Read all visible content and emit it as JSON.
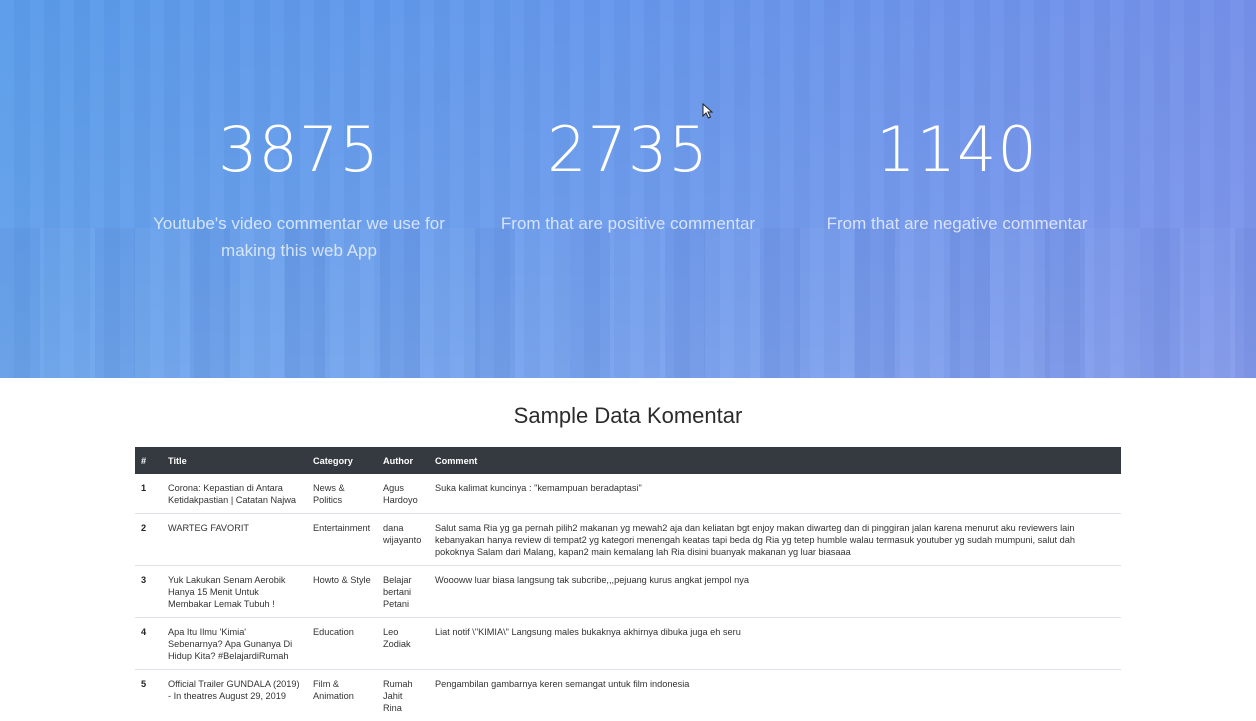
{
  "hero": {
    "stats": [
      {
        "number": "3875",
        "label": "Youtube's video commentar we use for making this web App"
      },
      {
        "number": "2735",
        "label": "From that are positive commentar"
      },
      {
        "number": "1140",
        "label": "From that are negative commentar"
      }
    ]
  },
  "section": {
    "title": "Sample Data Komentar"
  },
  "table": {
    "headers": [
      "#",
      "Title",
      "Category",
      "Author",
      "Comment"
    ],
    "rows": [
      {
        "num": "1",
        "title": "Corona: Kepastian di Antara Ketidakpastian | Catatan Najwa",
        "category": "News & Politics",
        "author": "Agus Hardoyo",
        "comment": "Suka kalimat kuncinya : \"kemampuan beradaptasi\""
      },
      {
        "num": "2",
        "title": "WARTEG FAVORIT",
        "category": "Entertainment",
        "author": "dana wijayanto",
        "comment": "Salut sama Ria yg ga pernah pilih2 makanan yg mewah2 aja dan keliatan bgt enjoy makan diwarteg dan di pinggiran jalan karena menurut aku reviewers lain kebanyakan hanya review di tempat2 yg kategori menengah keatas tapi beda dg Ria yg tetep humble walau termasuk youtuber yg sudah mumpuni, salut dah pokoknya Salam dari Malang, kapan2 main kemalang lah Ria disini buanyak makanan yg luar biasaaa"
      },
      {
        "num": "3",
        "title": "Yuk Lakukan Senam Aerobik Hanya 15 Menit Untuk Membakar Lemak Tubuh !",
        "category": "Howto & Style",
        "author": "Belajar bertani Petani",
        "comment": "Woooww luar biasa langsung tak subcribe,,,pejuang kurus angkat jempol nya"
      },
      {
        "num": "4",
        "title": "Apa Itu Ilmu 'Kimia' Sebenarnya? Apa Gunanya Di Hidup Kita? #BelajardiRumah",
        "category": "Education",
        "author": "Leo Zodiak",
        "comment": "Liat notif \\\"KIMIA\\\" Langsung males bukaknya akhirnya dibuka juga eh seru"
      },
      {
        "num": "5",
        "title": "Official Trailer GUNDALA (2019) - In theatres August 29, 2019",
        "category": "Film & Animation",
        "author": "Rumah Jahit Rina",
        "comment": "Pengambilan gambarnya keren semangat untuk film indonesia"
      }
    ]
  }
}
